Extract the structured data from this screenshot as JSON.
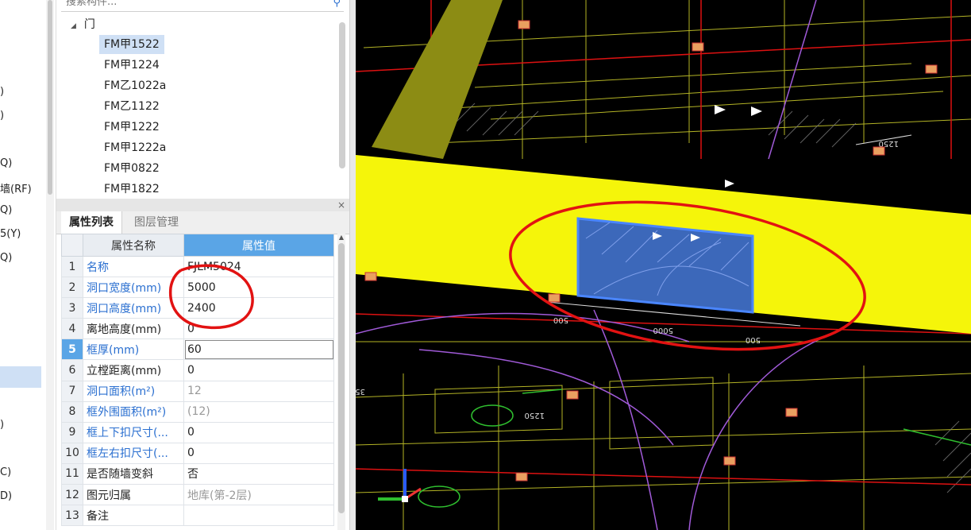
{
  "left_fragments": [
    ")",
    ")",
    "Q)",
    "墙(RF)",
    "Q)",
    "5(Y)",
    "Q)",
    ")",
    "C)",
    "D)"
  ],
  "search": {
    "placeholder": "搜索构件..."
  },
  "tree": {
    "root_label": "门",
    "items": [
      "FM甲1522",
      "FM甲1224",
      "FM乙1022a",
      "FM乙1122",
      "FM甲1222",
      "FM甲1222a",
      "FM甲0822",
      "FM甲1822"
    ],
    "selected_index": 0
  },
  "panel_close": "×",
  "tabs": {
    "properties": "属性列表",
    "layers": "图层管理"
  },
  "table": {
    "header_name": "属性名称",
    "header_value": "属性值",
    "active_row": 5,
    "rows": [
      {
        "n": "1",
        "name": "名称",
        "value": "FJLM5024",
        "blue": true
      },
      {
        "n": "2",
        "name": "洞口宽度(mm)",
        "value": "5000",
        "blue": true
      },
      {
        "n": "3",
        "name": "洞口高度(mm)",
        "value": "2400",
        "blue": true
      },
      {
        "n": "4",
        "name": "离地高度(mm)",
        "value": "0",
        "blue": false
      },
      {
        "n": "5",
        "name": "框厚(mm)",
        "value": "60",
        "blue": true
      },
      {
        "n": "6",
        "name": "立樘距离(mm)",
        "value": "0",
        "blue": false
      },
      {
        "n": "7",
        "name": "洞口面积(m²)",
        "value": "12",
        "blue": true,
        "gray": true
      },
      {
        "n": "8",
        "name": "框外围面积(m²)",
        "value": "(12)",
        "blue": true,
        "gray": true
      },
      {
        "n": "9",
        "name": "框上下扣尺寸(...",
        "value": "0",
        "blue": true
      },
      {
        "n": "10",
        "name": "框左右扣尺寸(...",
        "value": "0",
        "blue": true
      },
      {
        "n": "11",
        "name": "是否随墙变斜",
        "value": "否",
        "blue": false
      },
      {
        "n": "12",
        "name": "图元归属",
        "value": "地库(第-2层)",
        "blue": false,
        "gray": true
      },
      {
        "n": "13",
        "name": "备注",
        "value": "",
        "blue": false
      }
    ]
  },
  "viewport": {
    "dimension_labels": [
      "1250",
      "5000",
      "500",
      "500",
      "1250",
      "35"
    ],
    "colors": {
      "wall": "#f5f50a",
      "door_selected": "#1b4fd9",
      "annotation": "#e21212",
      "grid": "#d11",
      "purple": "#a05ad8",
      "green": "#2f9f2f"
    }
  }
}
